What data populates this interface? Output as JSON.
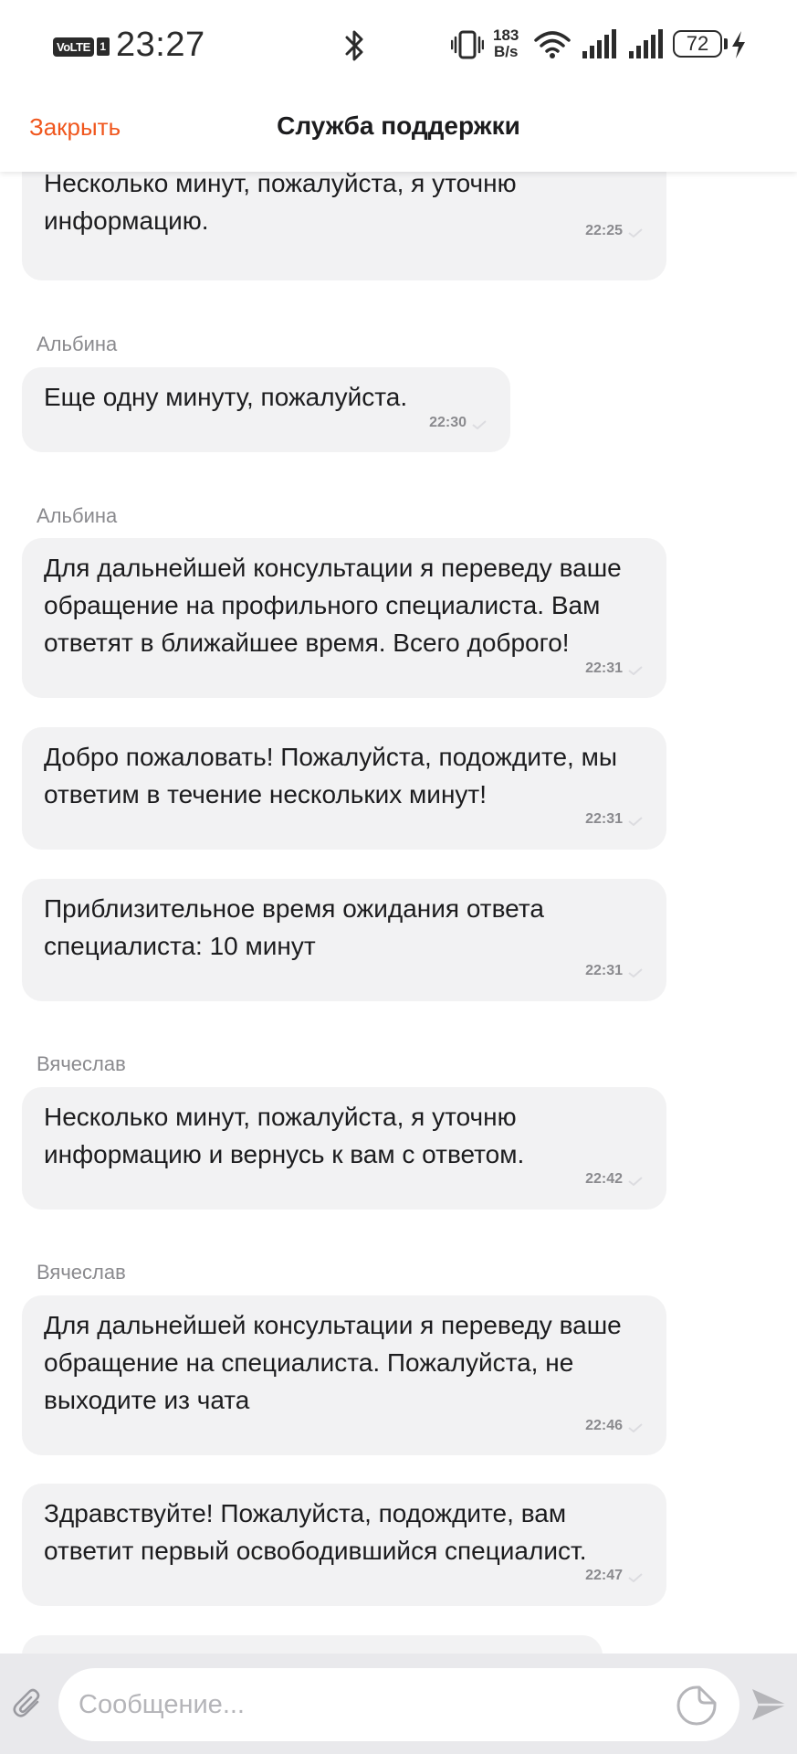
{
  "status_bar": {
    "volte": "VoLTE",
    "sim_number": "1",
    "time": "23:27",
    "speed_value": "183",
    "speed_unit": "B/s",
    "battery": "72"
  },
  "header": {
    "close_label": "Закрыть",
    "title": "Служба поддержки"
  },
  "messages": [
    {
      "sender": "",
      "text": "Несколько минут, пожалуйста, я уточню информацию.",
      "time": "22:25"
    },
    {
      "sender": "Альбина",
      "text": "Еще одну минуту, пожалуйста.",
      "time": "22:30"
    },
    {
      "sender": "Альбина",
      "text": "Для дальнейшей консультации я переведу ваше обращение на профильного специалиста. Вам ответят в ближайшее время. Всего доброго!",
      "time": "22:31"
    },
    {
      "sender": "",
      "text": "Добро пожаловать! Пожалуйста, подождите, мы ответим в течение нескольких минут!",
      "time": "22:31"
    },
    {
      "sender": "",
      "text": "Приблизительное время ожидания ответа специалиста: 10 минут",
      "time": "22:31"
    },
    {
      "sender": "Вячеслав",
      "text": "Несколько минут, пожалуйста, я уточню информацию и вернусь к вам с ответом.",
      "time": "22:42"
    },
    {
      "sender": "Вячеслав",
      "text": "Для дальнейшей консультации я переведу ваше обращение на специалиста. Пожалуйста, не выходите из чата",
      "time": "22:46"
    },
    {
      "sender": "",
      "text": "Здравствуйте! Пожалуйста, подождите, вам ответит первый освободившийся специалист.",
      "time": "22:47"
    }
  ],
  "input": {
    "placeholder": "Сообщение...",
    "value": ""
  },
  "icons": {
    "attach": "paperclip-icon",
    "sticker": "sticker-icon",
    "send": "send-icon"
  },
  "colors": {
    "accent": "#f0571e",
    "bubble": "#f2f2f3",
    "muted_text": "#8a8a8e"
  }
}
